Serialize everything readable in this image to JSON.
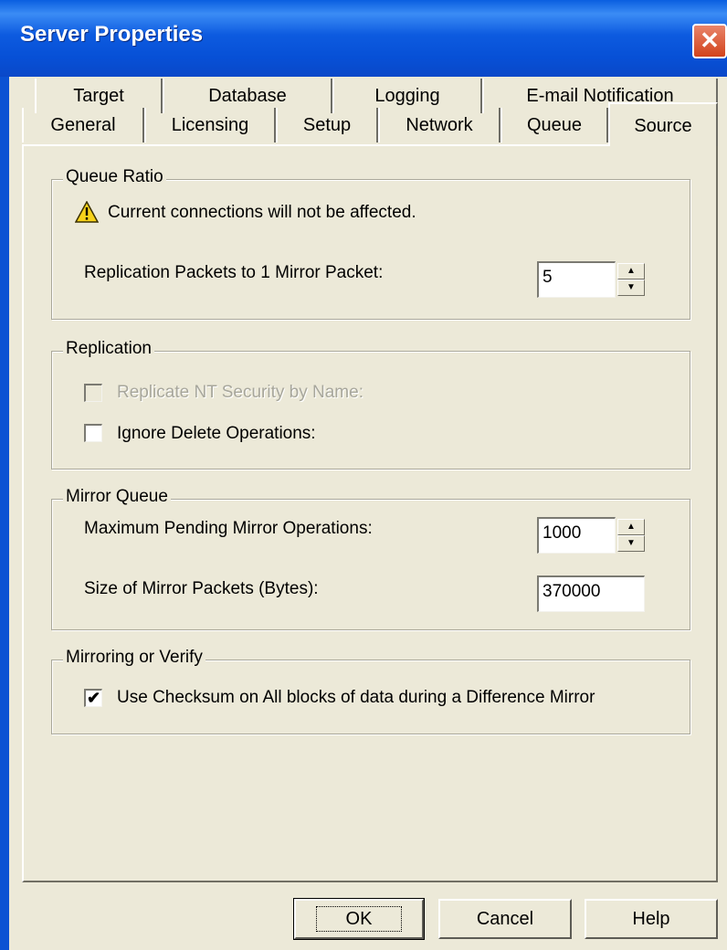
{
  "window": {
    "title": "Server Properties",
    "close_glyph": "✕"
  },
  "tabs": {
    "row1": [
      "Target",
      "Database",
      "Logging",
      "E-mail Notification"
    ],
    "row2": [
      "General",
      "Licensing",
      "Setup",
      "Network",
      "Queue",
      "Source"
    ],
    "active": "Source"
  },
  "queue_ratio": {
    "legend": "Queue Ratio",
    "warning_icon": "warning-icon",
    "warning_text": "Current connections will not be affected.",
    "packets_label": "Replication Packets to 1 Mirror Packet:",
    "packets_value": "5"
  },
  "replication": {
    "legend": "Replication",
    "nt_security_label": "Replicate NT Security by Name:",
    "nt_security_checked": false,
    "ignore_delete_label": "Ignore Delete Operations:",
    "ignore_delete_checked": false
  },
  "mirror_queue": {
    "legend": "Mirror Queue",
    "max_pending_label": "Maximum Pending Mirror Operations:",
    "max_pending_value": "1000",
    "packet_size_label": "Size of Mirror Packets (Bytes):",
    "packet_size_value": "370000"
  },
  "mirroring_verify": {
    "legend": "Mirroring or Verify",
    "checksum_label": "Use Checksum on All blocks of data during a Difference Mirror",
    "checksum_checked": true,
    "check_glyph": "✔"
  },
  "buttons": {
    "ok": "OK",
    "cancel": "Cancel",
    "help": "Help"
  },
  "spin_glyphs": {
    "up": "▲",
    "down": "▼"
  }
}
